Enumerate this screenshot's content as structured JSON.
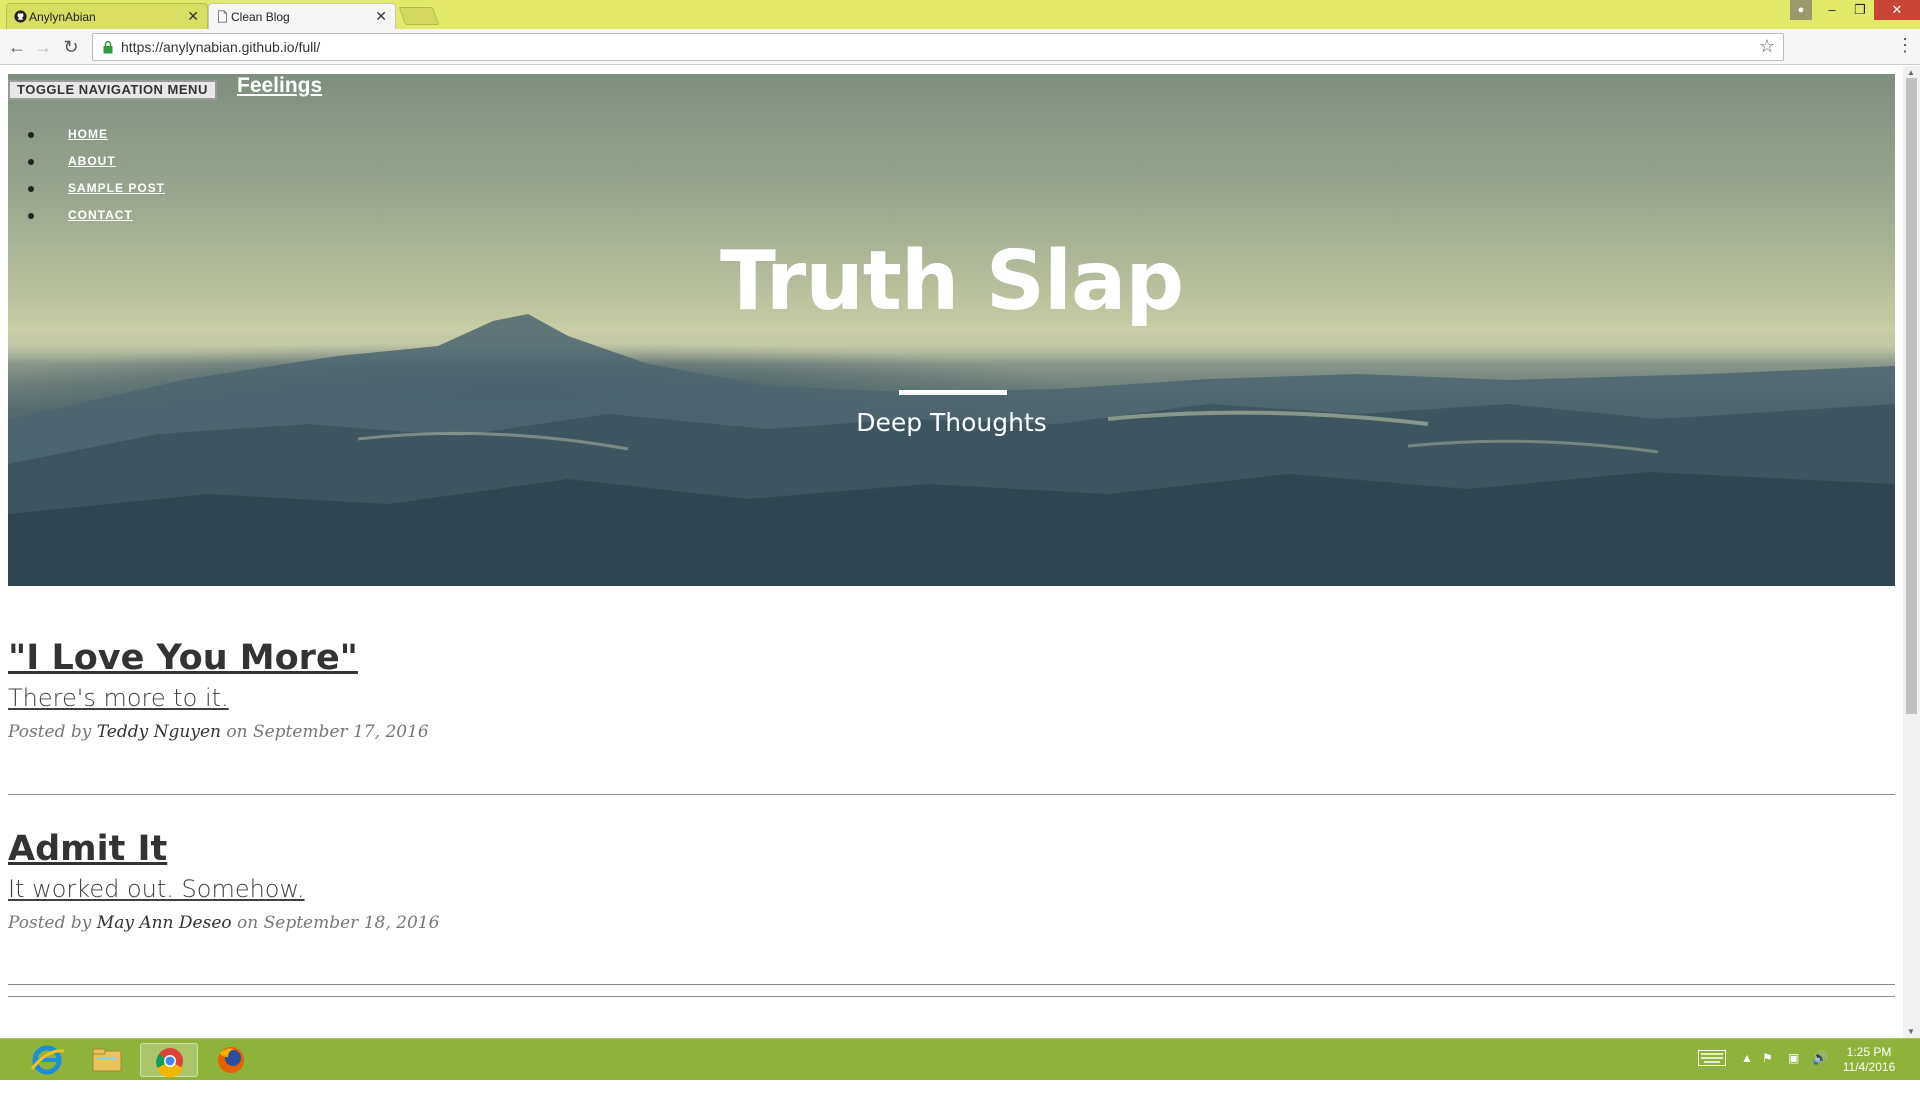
{
  "browser": {
    "tabs": [
      {
        "label": "AnylynAbian",
        "icon": "github-icon",
        "active": false
      },
      {
        "label": "Clean Blog",
        "icon": "page-icon",
        "active": true
      }
    ],
    "url": "https://anylynabian.github.io/full/",
    "accent": "#e3ea6a"
  },
  "site": {
    "toggle_label": "TOGGLE NAVIGATION MENU",
    "brand": "Feelings",
    "nav": [
      "HOME",
      "ABOUT",
      "SAMPLE POST",
      "CONTACT"
    ],
    "hero_title": "Truth Slap",
    "hero_subtitle": "Deep Thoughts"
  },
  "posts": [
    {
      "title": "\"I Love You More\"",
      "subtitle": "There's more to it.",
      "meta_prefix": "Posted by",
      "author": "Teddy Nguyen",
      "meta_on": "on",
      "date": "September 17, 2016"
    },
    {
      "title": "Admit It",
      "subtitle": "It worked out. Somehow.",
      "meta_prefix": "Posted by",
      "author": "May Ann Deseo",
      "meta_on": "on",
      "date": "September 18, 2016"
    }
  ],
  "taskbar": {
    "apps": [
      "internet-explorer-icon",
      "file-explorer-icon",
      "chrome-icon",
      "firefox-icon"
    ],
    "time": "1:25 PM",
    "date": "11/4/2016",
    "color": "#8fb23a"
  }
}
